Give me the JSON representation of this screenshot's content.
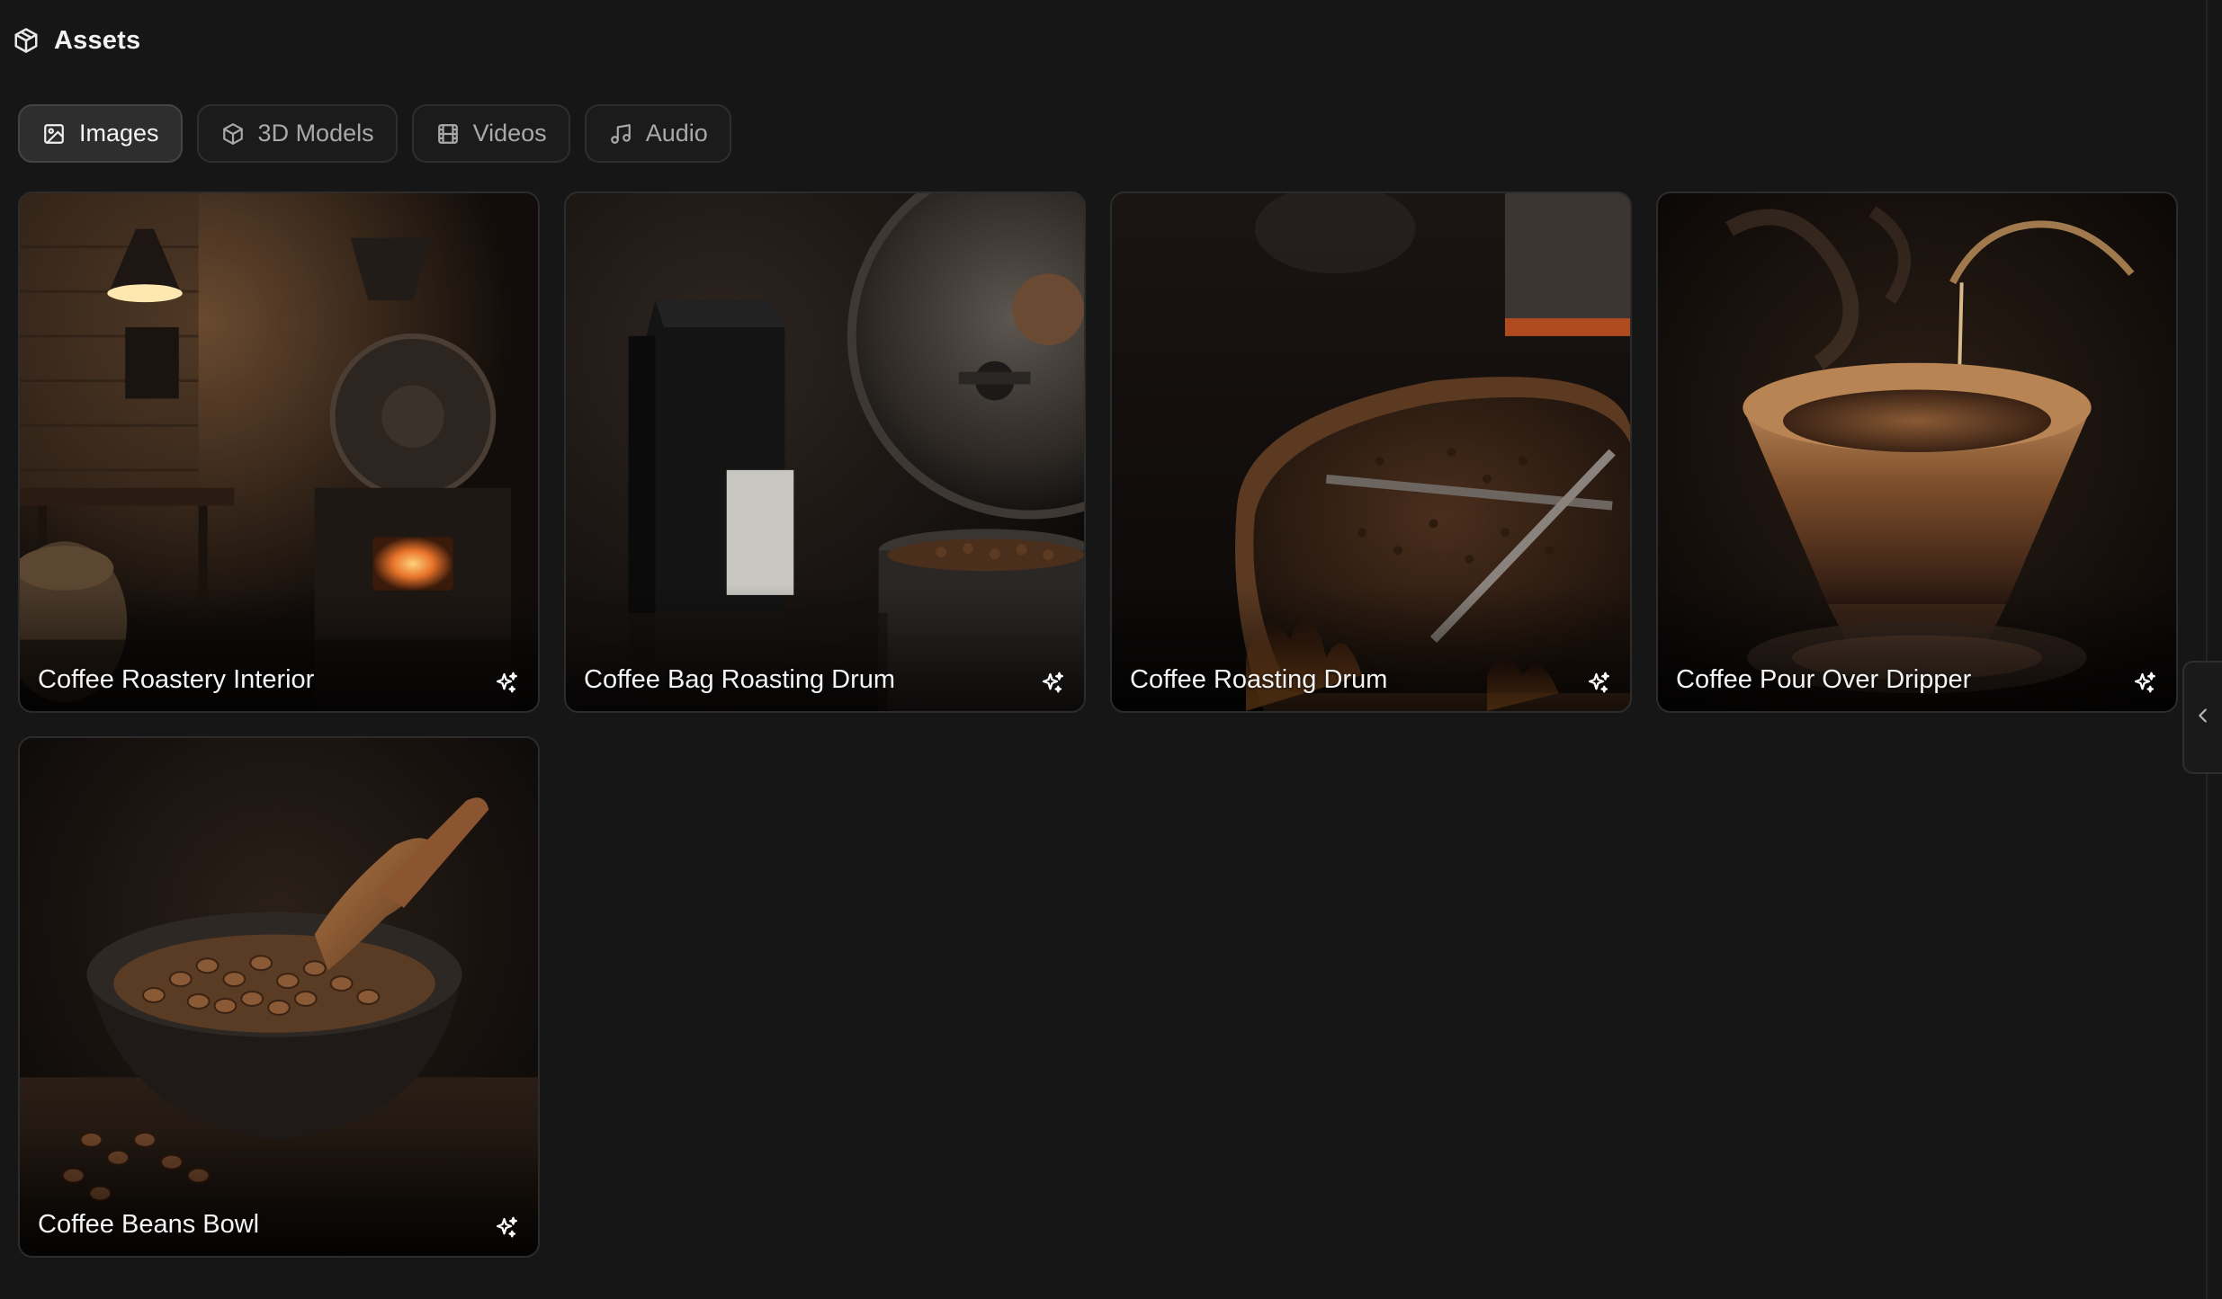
{
  "header": {
    "title": "Assets",
    "icon": "cube-icon"
  },
  "tabs": [
    {
      "label": "Images",
      "icon": "image-icon",
      "active": true
    },
    {
      "label": "3D Models",
      "icon": "cube-icon",
      "active": false
    },
    {
      "label": "Videos",
      "icon": "film-icon",
      "active": false
    },
    {
      "label": "Audio",
      "icon": "music-note-icon",
      "active": false
    }
  ],
  "assets": [
    {
      "title": "Coffee Roastery Interior",
      "badge_icon": "sparkles-icon"
    },
    {
      "title": "Coffee Bag Roasting Drum",
      "badge_icon": "sparkles-icon"
    },
    {
      "title": "Coffee Roasting Drum",
      "badge_icon": "sparkles-icon"
    },
    {
      "title": "Coffee Pour Over Dripper",
      "badge_icon": "sparkles-icon"
    },
    {
      "title": "Coffee Beans Bowl",
      "badge_icon": "sparkles-icon"
    }
  ],
  "side_panel": {
    "toggle_icon": "chevron-left-icon"
  },
  "colors": {
    "background": "#161616",
    "tab_active_bg": "#2e2e2e",
    "tab_border": "#2e2e2e",
    "text_primary": "#f2f2f2",
    "text_muted": "#a9a9a9"
  }
}
